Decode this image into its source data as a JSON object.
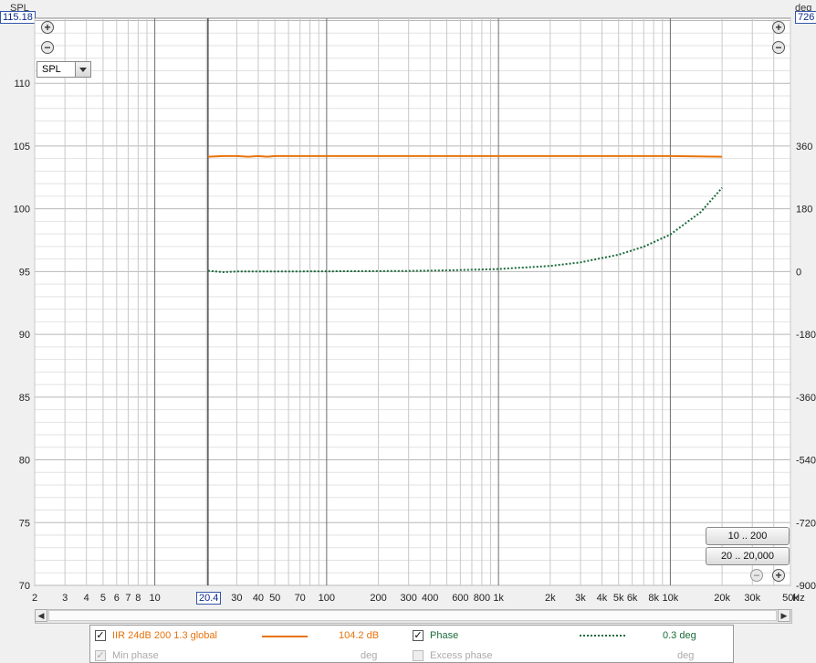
{
  "left_axis": {
    "unit": "SPL",
    "max_readout": "115.18",
    "ticks": [
      "110",
      "105",
      "100",
      "95",
      "90",
      "85",
      "80",
      "75",
      "70"
    ],
    "tick_values": [
      110,
      105,
      100,
      95,
      90,
      85,
      80,
      75,
      70
    ],
    "range": [
      70,
      115.18
    ]
  },
  "right_axis": {
    "unit": "deg",
    "max_readout": "726",
    "ticks": [
      "360",
      "180",
      "0",
      "-180",
      "-360",
      "-540",
      "-720",
      "-900"
    ],
    "tick_values": [
      360,
      180,
      0,
      -180,
      -360,
      -540,
      -720,
      -900
    ],
    "range": [
      -900,
      726
    ]
  },
  "x_axis": {
    "unit": "Hz",
    "range": [
      2,
      50000
    ],
    "scale": "log",
    "readout": "20.4",
    "labels": [
      {
        "v": 2,
        "t": "2"
      },
      {
        "v": 3,
        "t": "3"
      },
      {
        "v": 4,
        "t": "4"
      },
      {
        "v": 5,
        "t": "5"
      },
      {
        "v": 6,
        "t": "6"
      },
      {
        "v": 7,
        "t": "7"
      },
      {
        "v": 8,
        "t": "8"
      },
      {
        "v": 10,
        "t": "10"
      },
      {
        "v": 30,
        "t": "30"
      },
      {
        "v": 40,
        "t": "40"
      },
      {
        "v": 50,
        "t": "50"
      },
      {
        "v": 70,
        "t": "70"
      },
      {
        "v": 100,
        "t": "100"
      },
      {
        "v": 200,
        "t": "200"
      },
      {
        "v": 300,
        "t": "300"
      },
      {
        "v": 400,
        "t": "400"
      },
      {
        "v": 600,
        "t": "600"
      },
      {
        "v": 800,
        "t": "800"
      },
      {
        "v": 1000,
        "t": "1k"
      },
      {
        "v": 2000,
        "t": "2k"
      },
      {
        "v": 3000,
        "t": "3k"
      },
      {
        "v": 4000,
        "t": "4k"
      },
      {
        "v": 5000,
        "t": "5k"
      },
      {
        "v": 6000,
        "t": "6k"
      },
      {
        "v": 8000,
        "t": "8k"
      },
      {
        "v": 10000,
        "t": "10k"
      },
      {
        "v": 20000,
        "t": "20k"
      },
      {
        "v": 30000,
        "t": "30k"
      },
      {
        "v": 50000,
        "t": "50k"
      }
    ]
  },
  "controls": {
    "spl_dropdown": "SPL",
    "range_btn_1": "10 .. 200",
    "range_btn_2": "20 .. 20,000",
    "zoom_in_symbol": "+",
    "zoom_out_symbol": "−"
  },
  "chart_data": {
    "type": "line",
    "xlabel": "Hz",
    "ylabel": "SPL",
    "y2label": "deg",
    "xlim": [
      2,
      50000
    ],
    "ylim": [
      70,
      115.18
    ],
    "y2lim": [
      -900,
      726
    ],
    "grid": true,
    "series": [
      {
        "name": "IIR 24dB 200 1.3 global",
        "axis": "left",
        "color": "#e8730c",
        "style": "solid",
        "x": [
          20.4,
          25,
          30,
          35,
          40,
          45,
          50,
          100,
          1000,
          10000,
          20000
        ],
        "y": [
          104.15,
          104.2,
          104.2,
          104.15,
          104.2,
          104.15,
          104.2,
          104.2,
          104.2,
          104.2,
          104.15
        ]
      },
      {
        "name": "Phase",
        "axis": "right",
        "color": "#1a6a3a",
        "style": "dotted",
        "x": [
          20.4,
          25,
          30,
          50,
          100,
          300,
          500,
          1000,
          2000,
          3000,
          5000,
          7000,
          10000,
          15000,
          20000
        ],
        "y": [
          2,
          -2,
          0,
          0,
          0.5,
          1.5,
          3,
          7,
          16,
          26,
          48,
          71,
          106,
          170,
          240
        ]
      }
    ]
  },
  "legend": {
    "rows": [
      {
        "label": "IIR 24dB 200 1.3 global",
        "value": "104.2 dB",
        "checked": "✓",
        "color": "#e8730c",
        "style": "solid"
      },
      {
        "label": "Phase",
        "value": "0.3 deg",
        "checked": "✓",
        "color": "#1a6a3a",
        "style": "dotted"
      },
      {
        "label": "Min phase",
        "value": "deg",
        "checked": "✓",
        "color": "#aaaaaa",
        "style": "none"
      },
      {
        "label": "Excess phase",
        "value": "deg",
        "checked": "",
        "color": "#aaaaaa",
        "style": "none"
      }
    ]
  },
  "scrollbar": {
    "left_arrow": "◀",
    "right_arrow": "▶"
  }
}
